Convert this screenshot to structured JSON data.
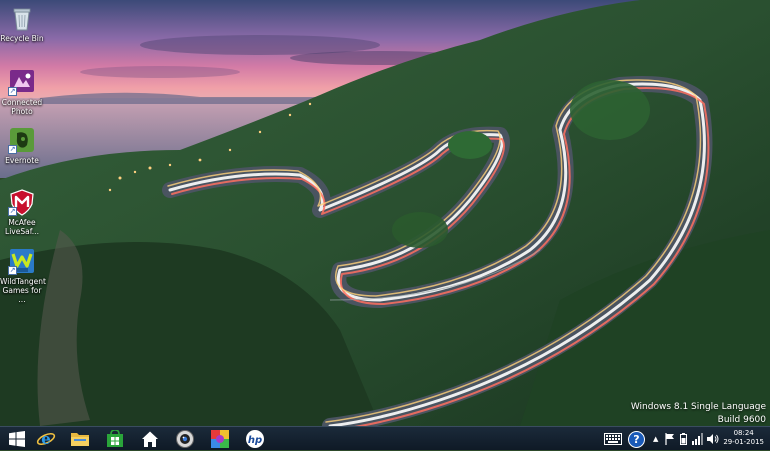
{
  "desktop": {
    "icons": [
      {
        "label": "Recycle Bin"
      },
      {
        "label": "Connected Photo"
      },
      {
        "label": "Evernote"
      },
      {
        "label": "McAfee LiveSaf..."
      },
      {
        "label": "WildTangent Games for ..."
      }
    ]
  },
  "watermark": {
    "line1": "Windows 8.1 Single Language",
    "line2": "Build 9600"
  },
  "taskbar": {
    "start_icon": "windows-logo-icon",
    "pinned": [
      {
        "name": "internet-explorer-icon"
      },
      {
        "name": "file-explorer-icon"
      },
      {
        "name": "store-icon"
      },
      {
        "name": "home-icon"
      },
      {
        "name": "webcam-icon"
      },
      {
        "name": "photos-icon"
      },
      {
        "name": "hp-icon"
      }
    ]
  },
  "tray": {
    "help_glyph": "?",
    "time": "08:24",
    "date": "29-01-2015"
  }
}
